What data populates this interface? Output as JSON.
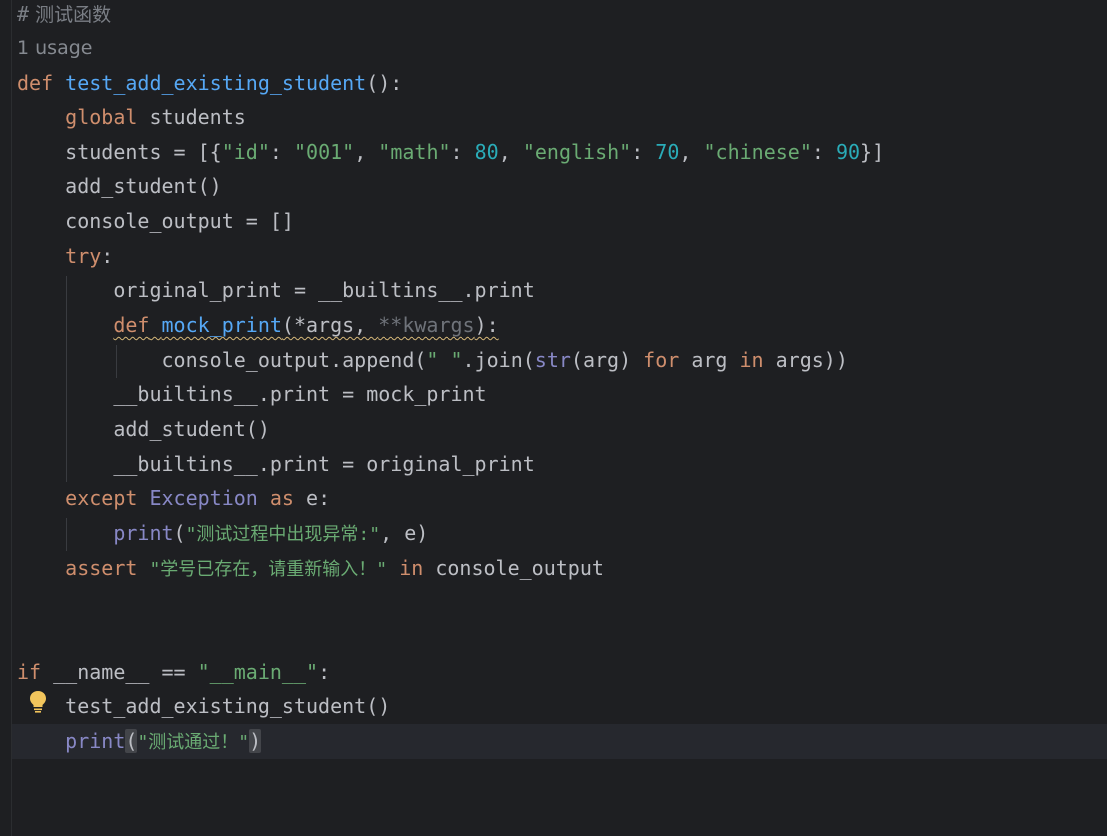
{
  "editor": {
    "language": "python",
    "colors": {
      "background": "#1e1f22",
      "keyword": "#cf8e6d",
      "function": "#56a8f5",
      "string": "#6aab73",
      "number": "#2aacb8",
      "builtin": "#8888c6",
      "comment": "#7a7e85",
      "text": "#bcbec4"
    },
    "comment_line": {
      "hash": "#",
      "text": " 测试函数"
    },
    "usage_hint": "1 usage",
    "func_def": {
      "kw": "def",
      "name": "test_add_existing_student",
      "tail": "():"
    },
    "global_line": {
      "kw": "global",
      "rest": " students"
    },
    "students_line": {
      "lhs": "students = [{",
      "k1": "\"id\"",
      "v1": "\"001\"",
      "k2": "\"math\"",
      "v2": "80",
      "k3": "\"english\"",
      "v3": "70",
      "k4": "\"chinese\"",
      "v4": "90",
      "end": "}]"
    },
    "add_student_call": "add_student()",
    "console_output_line": "console_output = []",
    "try_line": {
      "kw": "try",
      "colon": ":"
    },
    "original_print_line": "original_print = __builtins__.print",
    "mock_def": {
      "kw": "def",
      "name": "mock_print",
      "open": "(*args, ",
      "kwargs": "**kwargs",
      "close": "):"
    },
    "append_line": {
      "a": "console_output.append(",
      "s": "\" \"",
      "b": ".join(",
      "str_fn": "str",
      "c": "(arg) ",
      "for_kw": "for",
      "d": " arg ",
      "in_kw": "in",
      "e": " args))"
    },
    "set_mock_line": "__builtins__.print = mock_print",
    "add_student_call_2": "add_student()",
    "restore_line": "__builtins__.print = original_print",
    "except_line": {
      "kw": "except",
      "exc": "Exception",
      "as_kw": "as",
      "rest": " e:"
    },
    "print_err_line": {
      "fn": "print",
      "open": "(",
      "s": "\"测试过程中出现异常:\"",
      "rest": ", e)"
    },
    "assert_line": {
      "kw": "assert",
      "s": "\"学号已存在，请重新输入！\"",
      "in_kw": "in",
      "rest": " console_output"
    },
    "if_main_line": {
      "kw": "if",
      "mid": " __name__ == ",
      "s": "\"__main__\"",
      "colon": ":"
    },
    "call_test_line": "test_add_existing_student()",
    "print_pass_line": {
      "fn": "print",
      "open": "(",
      "s": "\"测试通过！\"",
      "close": ")"
    }
  }
}
